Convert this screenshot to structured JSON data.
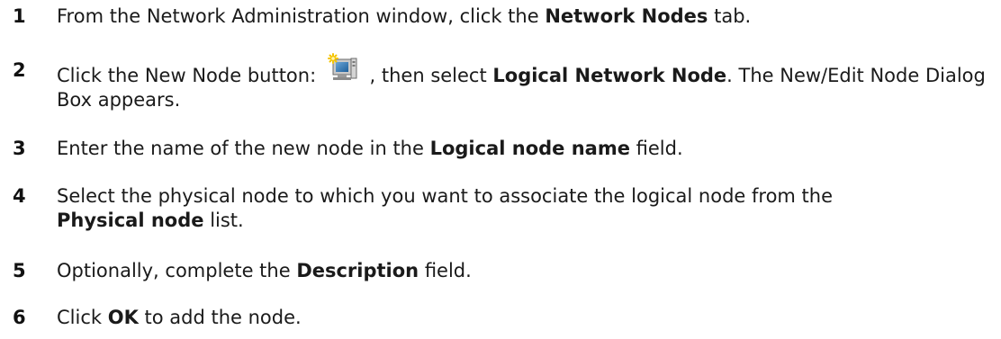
{
  "steps": [
    {
      "number": "1",
      "t1": "From the Network Administration window, click the ",
      "b1": "Network Nodes",
      "t2": " tab."
    },
    {
      "number": "2",
      "t1": "Click the New Node button: ",
      "icon": "new-node-icon",
      "t2": " , then select ",
      "b1": "Logical Network Node",
      "t3": ". The New/Edit Node Dialog Box appears."
    },
    {
      "number": "3",
      "t1": "Enter the name of the new node in the ",
      "b1": "Logical node name",
      "t2": " field."
    },
    {
      "number": "4",
      "t1": "Select the physical node to which you want to associate the logical node from the ",
      "b1": "Physical node",
      "t2": " list."
    },
    {
      "number": "5",
      "t1": "Optionally, complete the ",
      "b1": "Description",
      "t2": " field."
    },
    {
      "number": "6",
      "t1": "Click ",
      "b1": "OK",
      "t2": " to add the node."
    }
  ]
}
